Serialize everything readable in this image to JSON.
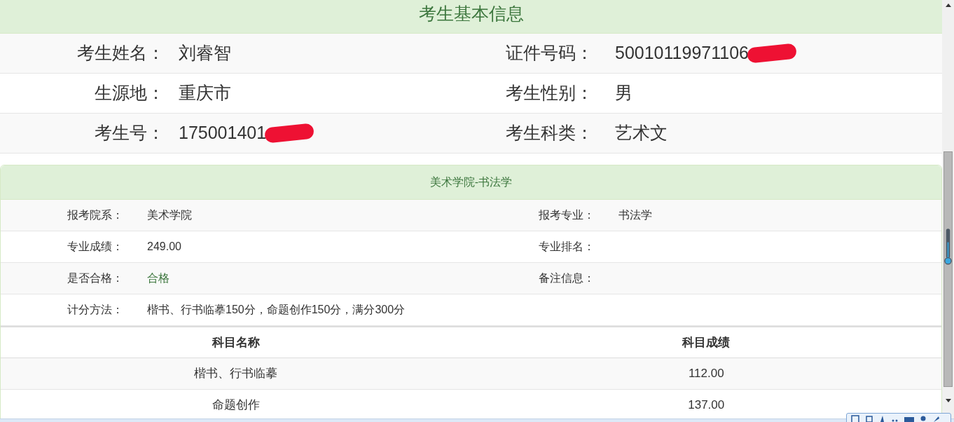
{
  "basic_info": {
    "title": "考生基本信息",
    "rows": [
      {
        "left": {
          "label": "考生姓名：",
          "value": "刘睿智",
          "redacted": false
        },
        "right": {
          "label": "证件号码：",
          "value": "50010119971106",
          "redacted": true
        }
      },
      {
        "left": {
          "label": "生源地：",
          "value": "重庆市",
          "redacted": false
        },
        "right": {
          "label": "考生性别：",
          "value": "男",
          "redacted": false
        }
      },
      {
        "left": {
          "label": "考生号：",
          "value": "175001401",
          "redacted": true
        },
        "right": {
          "label": "考生科类：",
          "value": "艺术文",
          "redacted": false
        }
      }
    ]
  },
  "major_panel": {
    "title": "美术学院-书法学",
    "rows": [
      [
        {
          "label": "报考院系：",
          "value": "美术学院"
        },
        {
          "label": "报考专业：",
          "value": "书法学"
        }
      ],
      [
        {
          "label": "专业成绩：",
          "value": "249.00"
        },
        {
          "label": "专业排名："
        }
      ],
      [
        {
          "label": "是否合格：",
          "value": "合格",
          "color": "#3c763d"
        },
        {
          "label": "备注信息："
        }
      ],
      [
        {
          "label": "计分方法：",
          "value": "楷书、行书临摹150分，命题创作150分，满分300分"
        }
      ]
    ],
    "table": {
      "columns": [
        "科目名称",
        "科目成绩"
      ],
      "rows": [
        [
          "楷书、行书临摹",
          "112.00"
        ],
        [
          "命题创作",
          "137.00"
        ]
      ]
    }
  }
}
